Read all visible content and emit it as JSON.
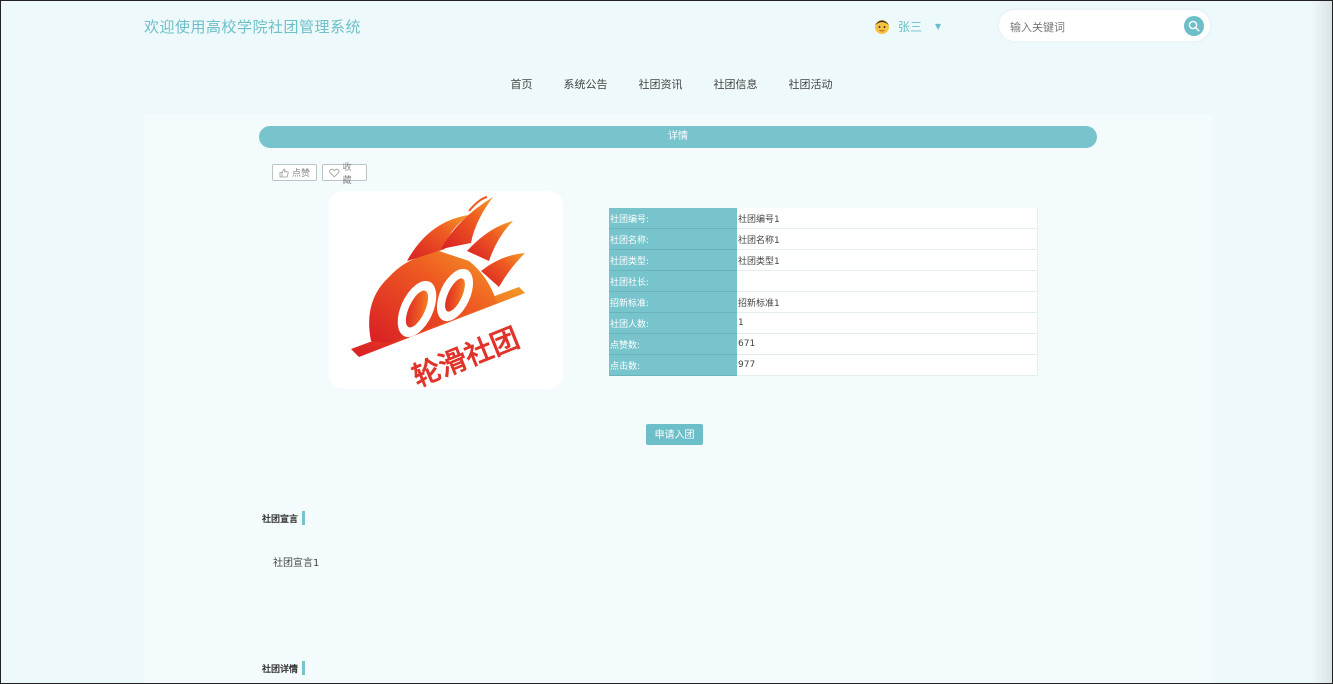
{
  "header": {
    "site_title": "欢迎使用高校学院社团管理系统",
    "user_name": "张三",
    "search_placeholder": "输入关键词"
  },
  "nav": {
    "items": [
      "首页",
      "系统公告",
      "社团资讯",
      "社团信息",
      "社团活动"
    ]
  },
  "detail": {
    "bar_label": "详情",
    "like_label": "点赞",
    "favorite_label": "收藏",
    "logo_text": "轮滑社团",
    "fields": [
      {
        "label": "社团编号:",
        "value": "社团编号1"
      },
      {
        "label": "社团名称:",
        "value": "社团名称1"
      },
      {
        "label": "社团类型:",
        "value": "社团类型1"
      },
      {
        "label": "社团社长:",
        "value": ""
      },
      {
        "label": "招新标准:",
        "value": "招新标准1"
      },
      {
        "label": "社团人数:",
        "value": "1"
      },
      {
        "label": "点赞数:",
        "value": "671"
      },
      {
        "label": "点击数:",
        "value": "977"
      }
    ],
    "apply_button": "申请入团"
  },
  "sections": {
    "manifesto_title": "社团宣言",
    "manifesto_body": "社团宣言1",
    "details_title": "社团详情"
  },
  "colors": {
    "accent": "#77c4cc",
    "title": "#6cbfc9",
    "background": "#eef9fb"
  }
}
